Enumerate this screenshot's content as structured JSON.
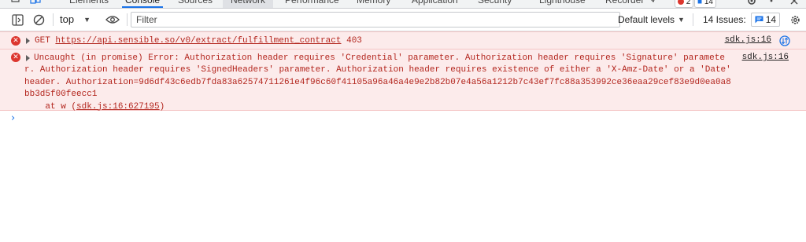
{
  "tabs": [
    {
      "label": "Elements"
    },
    {
      "label": "Console"
    },
    {
      "label": "Sources"
    },
    {
      "label": "Network"
    },
    {
      "label": "Performance"
    },
    {
      "label": "Memory"
    },
    {
      "label": "Application"
    },
    {
      "label": "Security"
    },
    {
      "label": "Lighthouse"
    },
    {
      "label": "Recorder"
    }
  ],
  "tab_badges": {
    "errors": "2",
    "messages": "14"
  },
  "toolbar": {
    "context": "top",
    "filter_placeholder": "Filter",
    "levels_label": "Default levels",
    "issues_label": "14 Issues:",
    "issues_count": "14"
  },
  "messages": [
    {
      "method": "GET",
      "url": "https://api.sensible.so/v0/extract/fulfillment_contract",
      "status": "403",
      "source": "sdk.js:16"
    },
    {
      "text": "Uncaught (in promise) Error: Authorization header requires 'Credential' parameter. Authorization header requires 'Signature' parameter. Authorization header requires 'SignedHeaders' parameter. Authorization header requires existence of either a 'X-Amz-Date' or a 'Date' header. Authorization=9d6df43c6edb7fda83a62574711261e4f96c60f41105a96a46a4e9e2b82b07e4a56a1212b7c43ef7fc88a353992ce36eaa29cef83e9d0ea0a8bb3d5f00feecc1",
      "stack_prefix": "    at w (",
      "stack_link": "sdk.js:16:627195",
      "stack_suffix": ")",
      "source": "sdk.js:16"
    }
  ],
  "colors": {
    "error_bg": "#fcebeb",
    "error_text": "#b3261e",
    "accent": "#1a73e8"
  }
}
